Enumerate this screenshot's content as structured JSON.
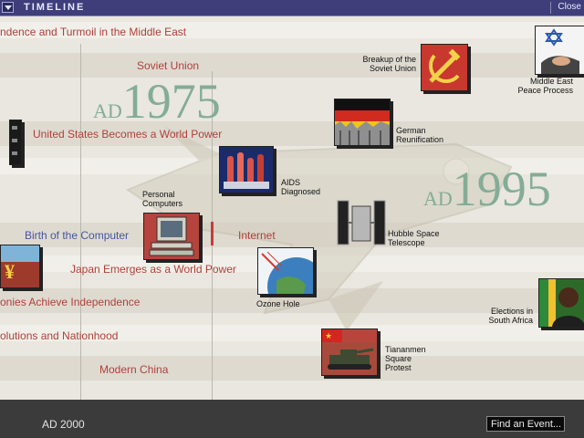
{
  "window": {
    "title": "TIMELINE",
    "close_label": "Close"
  },
  "rows": [
    {
      "label": "ndence and Turmoil in the Middle East"
    },
    {
      "label": "Soviet Union"
    },
    {
      "label": "United States Becomes a World Power"
    },
    {
      "label": "Birth of the Computer"
    },
    {
      "label": "Internet"
    },
    {
      "label": "Japan Emerges as a World Power"
    },
    {
      "label": "onies Achieve Independence"
    },
    {
      "label": "olutions and Nationhood"
    },
    {
      "label": "Modern China"
    }
  ],
  "years": {
    "left": {
      "prefix": "AD",
      "value": "1975"
    },
    "right": {
      "prefix": "AD",
      "value": "1995"
    }
  },
  "events": [
    {
      "label_1": "Breakup of the",
      "label_2": "Soviet Union",
      "icon": "hammer-sickle-icon"
    },
    {
      "label_1": "Middle East",
      "label_2": "Peace Process",
      "icon": "handshake-icon"
    },
    {
      "label_1": "German",
      "label_2": "Reunification",
      "icon": "berlin-wall-icon"
    },
    {
      "label_1": "AIDS",
      "label_2": "Diagnosed",
      "icon": "test-tubes-icon"
    },
    {
      "label_1": "Personal",
      "label_2": "Computers",
      "icon": "computer-icon"
    },
    {
      "label_1": "Hubble Space",
      "label_2": "Telescope",
      "icon": "telescope-icon"
    },
    {
      "label_1": "Ozone Hole",
      "icon": "globe-icon"
    },
    {
      "label_1": "Elections in",
      "label_2": "South Africa",
      "icon": "portrait-icon"
    },
    {
      "label_1": "Tiananmen",
      "label_2": "Square",
      "label_3": "Protest",
      "icon": "tank-icon"
    }
  ],
  "status": {
    "current_year": "AD 2000",
    "find_event_label": "Find an Event..."
  },
  "colors": {
    "titlebar": "#3f3d7a",
    "row_label": "#b0403a",
    "row_label_highlight": "#4555a0",
    "year_text": "#84ac96",
    "background": "#e9e7df",
    "bottom_bar": "#3b3b3b"
  }
}
